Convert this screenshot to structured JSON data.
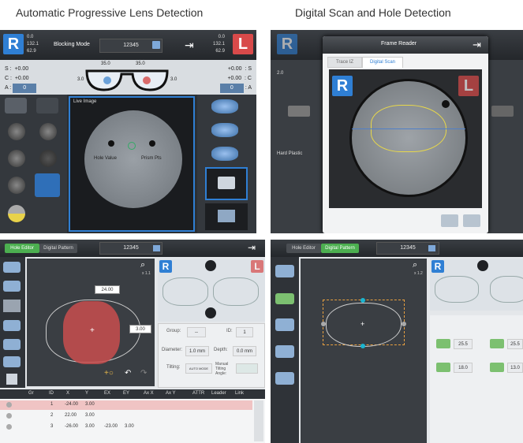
{
  "captions": {
    "top_left": "Automatic Progressive Lens Detection",
    "top_right": "Digital Scan and Hole Detection"
  },
  "panel1": {
    "right_label": "R",
    "left_label": "L",
    "mode": "Blocking Mode",
    "job": "12345",
    "left_stats": [
      "0.0",
      "132.1",
      "62.9"
    ],
    "right_stats": [
      "0.0",
      "132.1",
      "62.9"
    ],
    "s_label": "S :",
    "s_value": "+0.00",
    "c_label": "C :",
    "c_value": "+0.00",
    "a_label": "A :",
    "a_value": "0",
    "s_right": "+0.00",
    "s_right_label": ": S",
    "c_right": "+0.00",
    "c_right_label": ": C",
    "a_right": "0",
    "a_right_label": ": A",
    "pd_left": "35.0",
    "pd_right": "35.0",
    "height_left": "3.0",
    "height_right": "3.0",
    "live_image": "Live Image",
    "hole_value": "Hole Value",
    "prism_pts": "Prism Pts"
  },
  "panel2": {
    "title": "Frame Reader",
    "tab1": "Trace IZ",
    "tab2": "Digital Scan",
    "right_label": "R",
    "left_label": "L",
    "side_value": "2.0",
    "side_value2": "50.6",
    "hard_plastic": "Hard Plastic"
  },
  "panel3": {
    "tab1": "Hole Editor",
    "tab2": "Digital Pattern",
    "job": "12345",
    "zoom": "x 1.1",
    "dim_width": "24.00",
    "dim_height": "3.00",
    "right_label": "R",
    "left_label": "L",
    "group_label": "Group:",
    "group_value": "--",
    "id_label": "ID:",
    "id_value": "1",
    "diameter_label": "Diameter:",
    "diameter_value": "1.0 mm",
    "depth_label": "Depth:",
    "depth_value": "0.0 mm",
    "tilting_label": "Tilting:",
    "tilting_value": "AUTO MODE",
    "manual_label": "Manual Tilting Angle:",
    "headers": [
      "Gr",
      "ID",
      "X",
      "Y",
      "EX",
      "EY",
      "Ax X",
      "Ax Y",
      "ATTR",
      "Leader",
      "Link"
    ],
    "rows": [
      [
        "1",
        "-24.00",
        "3.00",
        "",
        "",
        "",
        "",
        "",
        "",
        ""
      ],
      [
        "2",
        "22.00",
        "3.00",
        "",
        "",
        "",
        "",
        "",
        "",
        ""
      ],
      [
        "3",
        "-26.00",
        "3.00",
        "-23.00",
        "3.00",
        "",
        "",
        "",
        "",
        ""
      ]
    ]
  },
  "panel4": {
    "tab1": "Hole Editor",
    "tab2": "Digital Pattern",
    "job": "12345",
    "zoom": "x 1.2",
    "right_label": "R",
    "v1": "25.5",
    "v2": "25.5",
    "v3": "18.0",
    "v4": "13.0"
  },
  "colors": {
    "accent_blue": "#2f7fd4",
    "accent_red": "#d84a4a",
    "tab_green": "#4caf50",
    "dark_bg": "#2b2f33"
  }
}
